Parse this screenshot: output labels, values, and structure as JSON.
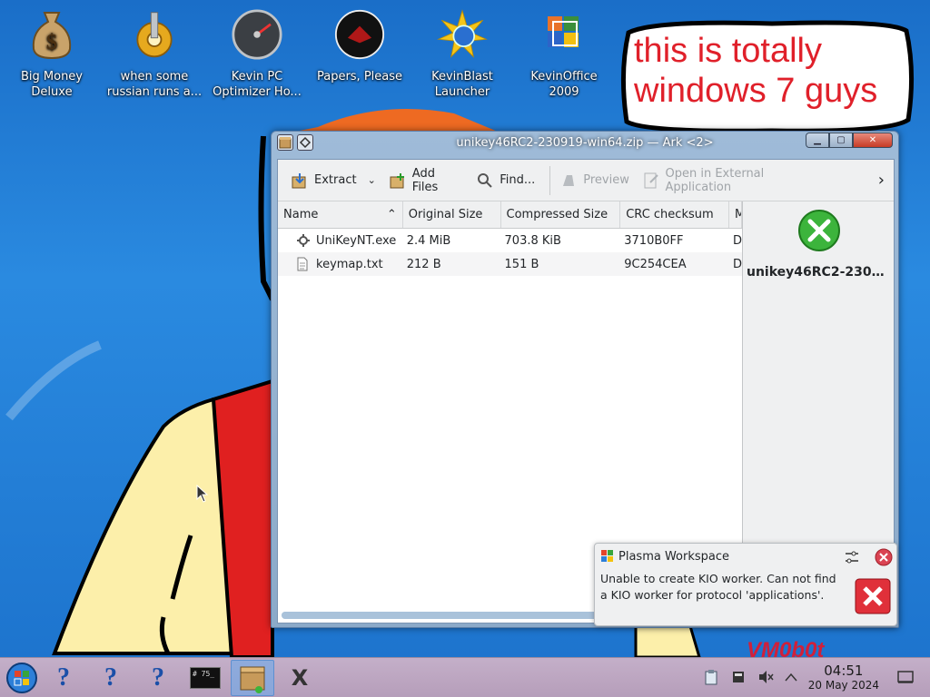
{
  "desktop": {
    "icons": [
      {
        "label": "Big Money Deluxe",
        "icon": "money-bag-icon"
      },
      {
        "label": "when some russian runs a...",
        "icon": "gear-icon"
      },
      {
        "label": "Kevin PC Optimizer Ho...",
        "icon": "gauge-icon"
      },
      {
        "label": "Papers, Please",
        "icon": "papers-please-icon"
      },
      {
        "label": "KevinBlast Launcher",
        "icon": "sunburst-icon"
      },
      {
        "label": "KevinOffice 2009",
        "icon": "office-icon"
      }
    ],
    "bubble_text": "this is totally windows 7 guys",
    "watermark": "VM0b0t"
  },
  "ark": {
    "title": "unikey46RC2-230919-win64.zip — Ark <2>",
    "toolbar": {
      "extract": "Extract",
      "add_files": "Add Files",
      "find": "Find...",
      "preview": "Preview",
      "open_external": "Open in External Application"
    },
    "columns": [
      "Name",
      "Original Size",
      "Compressed Size",
      "CRC checksum",
      "M"
    ],
    "files": [
      {
        "name": "UniKeyNT.exe",
        "original": "2.4 MiB",
        "compressed": "703.8 KiB",
        "crc": "3710B0FF",
        "m": "D"
      },
      {
        "name": "keymap.txt",
        "original": "212 B",
        "compressed": "151 B",
        "crc": "9C254CEA",
        "m": "D"
      }
    ],
    "info_name": "unikey46RC2-2309..."
  },
  "notification": {
    "app": "Plasma Workspace",
    "message": "Unable to create KIO worker. Can not find a KIO worker for protocol 'applications'."
  },
  "taskbar": {
    "time": "04:51",
    "date": "20 May 2024",
    "terminal_text": "# 75_"
  },
  "colors": {
    "accent": "#3daee9",
    "bubble_text": "#e0202a",
    "error_red": "#da4453"
  }
}
